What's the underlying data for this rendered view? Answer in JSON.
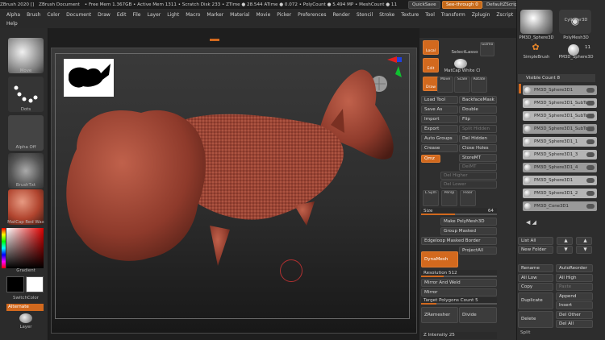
{
  "titlebar": {
    "app": "ZBrush 2020 []",
    "doc": "ZBrush Document",
    "stats": "• Free Mem 1.367GB • Active Mem 1311 • Scratch Disk 233 • ZTime ● 28.544 ATime ● 0.072 • PolyCount ● 5.494 MP • MeshCount ● 11",
    "quicksave": "QuickSave",
    "seethrough": "See-through 0",
    "defaultzscript": "DefaultZScript"
  },
  "menu": [
    "Alpha",
    "Brush",
    "Color",
    "Document",
    "Draw",
    "Edit",
    "File",
    "Layer",
    "Light",
    "Macro",
    "Marker",
    "Material",
    "Movie",
    "Picker",
    "Preferences",
    "Render",
    "Stencil",
    "Stroke",
    "Texture",
    "Tool",
    "Transform",
    "Zplugin",
    "Zscript"
  ],
  "help": "Help",
  "leftshelf": {
    "brush": "Move",
    "stroke": "Dots",
    "alpha": "Alpha Off",
    "texture": "BrushTxt",
    "material": "MatCap Red Wax",
    "gradient": "Gradient",
    "switchcolor": "SwitchColor",
    "alternate": "Alternate",
    "layer": "Layer"
  },
  "rpanel": {
    "local": "Local",
    "edit": "Edit",
    "draw": "Draw",
    "selectlasso": "SelectLasso",
    "matcap": "MatCap White Cl",
    "move": "Move",
    "scale": "Scale",
    "rotate": "Rotate",
    "gizmo": "Gizmo",
    "xyz": "L.Sym",
    "persp": "Persp",
    "floor": "Floor",
    "loadtool": "Load Tool",
    "backfacemask": "BackfaceMask",
    "saveas": "Save As",
    "double": "Double",
    "import": "Import",
    "flip": "Flip",
    "export": "Export",
    "splithidden": "Split Hidden",
    "autogroups": "Auto Groups",
    "delhidden": "Del Hidden",
    "crease": "Crease",
    "closeholes": "Close Holes",
    "storemt": "StoreMT",
    "deletemt": "DelMT",
    "qmz": "Qmz",
    "delhigher": "Del Higher",
    "dellower": "Del Lower",
    "size": "Size",
    "sizeval": "64",
    "makepolymesh": "Make PolyMesh3D",
    "groupmasked": "Group Masked",
    "edgeloop": "Edgeloop Masked Border",
    "projectall": "ProjectAll",
    "dynamesh": "DynaMesh",
    "resolution": "Resolution 512",
    "mirrorweld": "Mirror And Weld",
    "mirror": "Mirror",
    "targetpoly": "Target Polygons Count 5",
    "zremesher": "ZRemesher",
    "divide": "Divide",
    "zintensity": "Z Intensity 25",
    "subtool": "Subtool"
  },
  "rrpanel": {
    "tool1": "PM3D_Sphere3D",
    "tool2": "PolyMesh3D",
    "tool3": "SimpleBrush",
    "tool4": "PM3D_Sphere3D",
    "cylinder": "Cylinder3D",
    "count": "11",
    "visible": "Visible Count 8",
    "subtools": [
      "PM3D_Sphere3D1",
      "PM3D_Sphere3D1_SubTool1",
      "PM3D_Sphere3D1_SubTool1",
      "PM3D_Sphere3D1_SubTool2",
      "PM3D_Sphere3D1_1",
      "PM3D_Sphere3D1_3",
      "PM3D_Sphere3D1_4",
      "PM3D_Sphere3D1",
      "PM3D_Sphere3D1_2",
      "PM3D_Cone3D1"
    ],
    "listall": "List All",
    "newfolder": "New Folder",
    "rename": "Rename",
    "autoreorder": "AutoReorder",
    "alllow": "All Low",
    "allhigh": "All High",
    "copy": "Copy",
    "paste": "Paste",
    "append": "Append",
    "duplicate": "Duplicate",
    "insert": "Insert",
    "delete": "Delete",
    "delother": "Del Other",
    "delall": "Del All",
    "split": "Split"
  },
  "colors": {
    "accent": "#d2691e",
    "wax": "#8b3a2a"
  }
}
